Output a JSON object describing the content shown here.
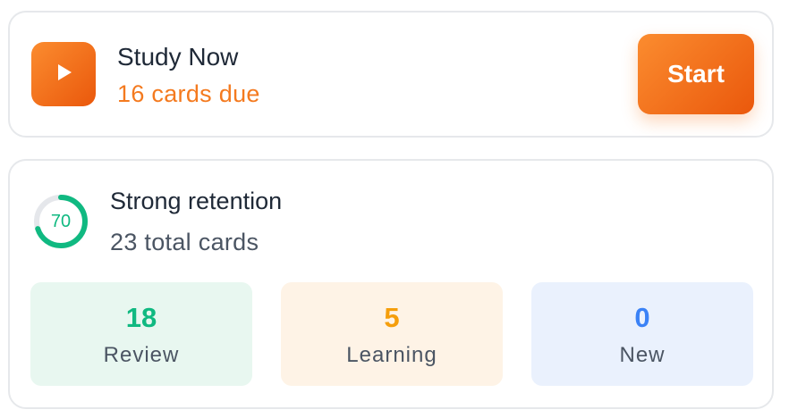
{
  "study": {
    "title": "Study Now",
    "subtitle": "16 cards due",
    "start_label": "Start",
    "icon": "play-icon"
  },
  "retention": {
    "score": "70",
    "score_fraction": 0.7,
    "title": "Strong retention",
    "subtitle": "23 total cards",
    "ring_color": "#10b981",
    "ring_track_color": "#e5e7eb"
  },
  "stats": [
    {
      "value": "18",
      "label": "Review",
      "color": "#10b981",
      "bg": "#e8f7f0"
    },
    {
      "value": "5",
      "label": "Learning",
      "color": "#f59e0b",
      "bg": "#fef3e6"
    },
    {
      "value": "0",
      "label": "New",
      "color": "#3b82f6",
      "bg": "#eaf1fd"
    }
  ],
  "colors": {
    "accent": "#f97316",
    "border": "#e6e8eb"
  }
}
